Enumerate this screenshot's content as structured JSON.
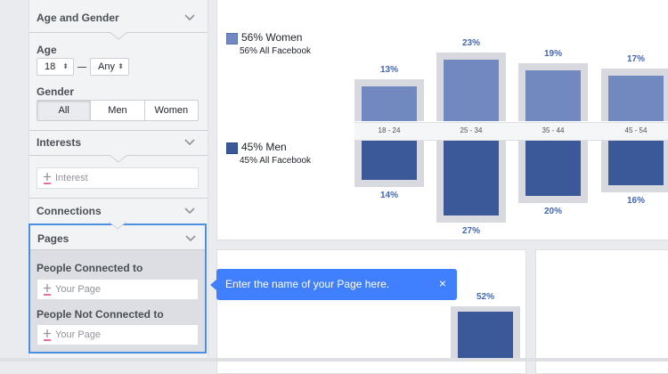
{
  "sidebar": {
    "age_gender": {
      "title": "Age and Gender"
    },
    "age": {
      "label": "Age",
      "min": "18",
      "max": "Any"
    },
    "gender": {
      "label": "Gender",
      "options": [
        "All",
        "Men",
        "Women"
      ],
      "selected": "All"
    },
    "interests": {
      "title": "Interests",
      "placeholder": "Interest"
    },
    "connections": {
      "title": "Connections"
    },
    "pages": {
      "title": "Pages",
      "connected_label": "People Connected to",
      "connected_placeholder": "Your Page",
      "not_connected_label": "People Not Connected to",
      "not_connected_placeholder": "Your Page"
    }
  },
  "tooltip": {
    "text": "Enter the name of your Page here.",
    "close": "×"
  },
  "chart_data": {
    "type": "bar",
    "categories": [
      "18 - 24",
      "25 - 34",
      "35 - 44",
      "45 - 54"
    ],
    "series": [
      {
        "name": "Women",
        "values": [
          13,
          23,
          19,
          17
        ],
        "color": "#7289bf"
      },
      {
        "name": "Men",
        "values": [
          14,
          27,
          20,
          16
        ],
        "color": "#3b5998"
      }
    ],
    "value_labels": {
      "women": [
        "13%",
        "23%",
        "19%",
        "17%"
      ],
      "men": [
        "14%",
        "27%",
        "20%",
        "16%"
      ]
    },
    "legend": {
      "women": {
        "title": "56% Women",
        "subtitle": "56% All Facebook"
      },
      "men": {
        "title": "45% Men",
        "subtitle": "45% All Facebook"
      }
    }
  },
  "lower_chart": {
    "values": [
      52
    ],
    "value_labels": [
      "52%"
    ],
    "color": "#3b5998"
  }
}
